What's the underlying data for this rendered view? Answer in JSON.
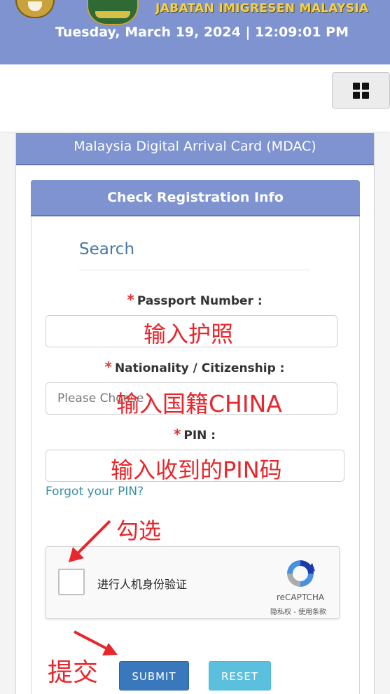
{
  "header": {
    "agency_name": "JABATAN IMIGRESEN MALAYSIA",
    "datetime": "Tuesday, March 19, 2024 | 12:09:01 PM",
    "logos": [
      "coat-of-arms-logo",
      "immigration-logo"
    ]
  },
  "navbar": {
    "menu_icon": "grid-icon"
  },
  "card": {
    "title": "Malaysia Digital Arrival Card (MDAC)",
    "section_title": "Check Registration Info"
  },
  "form": {
    "search_heading": "Search",
    "required_mark": "*",
    "passport_label": "Passport Number :",
    "nationality_label": "Nationality / Citizenship :",
    "nationality_placeholder": "Please Choose",
    "pin_label": "PIN :",
    "forgot_pin": "Forgot your PIN?"
  },
  "recaptcha": {
    "label": "进行人机身份验证",
    "brand": "reCAPTCHA",
    "links": "隐私权 - 使用条款"
  },
  "buttons": {
    "submit": "SUBMIT",
    "reset": "RESET"
  },
  "annotations": {
    "passport_hint": "输入护照",
    "nationality_hint": "输入国籍CHINA",
    "pin_hint": "输入收到的PIN码",
    "check_hint": "勾选",
    "submit_hint": "提交",
    "color": "#e8262c"
  },
  "colors": {
    "header_bg": "#7e93cf",
    "agency_text": "#f2d04a",
    "submit": "#3a78bd",
    "reset": "#5bc0de",
    "link": "#3b8ea5"
  }
}
